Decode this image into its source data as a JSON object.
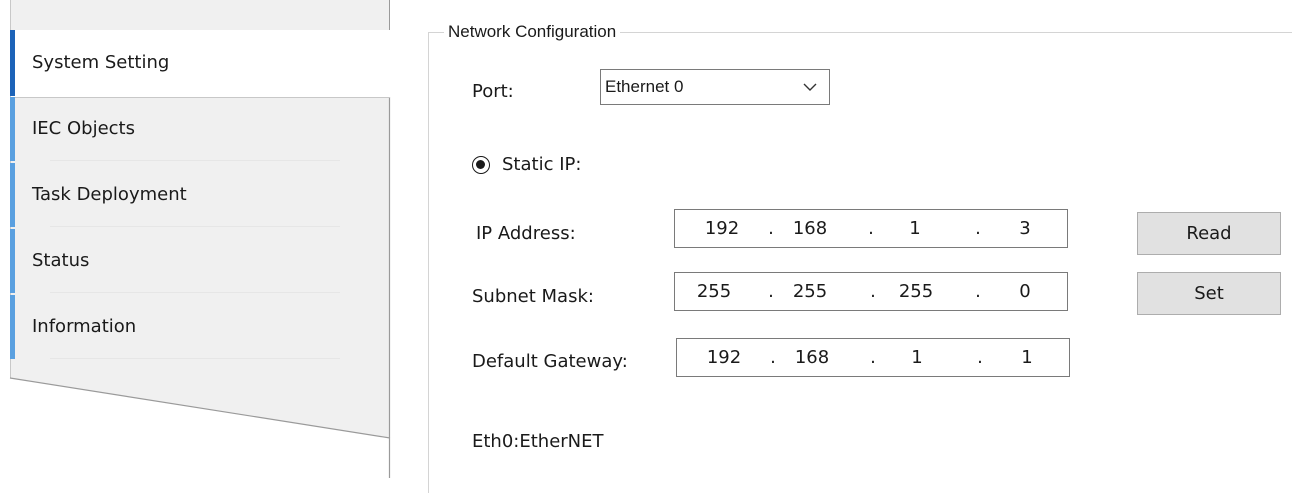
{
  "sidebar": {
    "items": [
      {
        "label": "System Setting",
        "active": true
      },
      {
        "label": "IEC Objects",
        "active": false
      },
      {
        "label": "Task Deployment",
        "active": false
      },
      {
        "label": "Status",
        "active": false
      },
      {
        "label": "Information",
        "active": false
      }
    ]
  },
  "network": {
    "group_title": "Network Configuration",
    "port_label": "Port:",
    "port_value": "Ethernet 0",
    "static_ip_label": "Static IP:",
    "static_ip_selected": true,
    "ip_address_label": "IP Address:",
    "ip_address": [
      "192",
      "168",
      "1",
      "3"
    ],
    "subnet_mask_label": "Subnet Mask:",
    "subnet_mask": [
      "255",
      "255",
      "255",
      "0"
    ],
    "default_gateway_label": "Default Gateway:",
    "default_gateway": [
      "192",
      "168",
      "1",
      "1"
    ],
    "ip_separator": ".",
    "read_button": "Read",
    "set_button": "Set",
    "interface_text": "Eth0:EtherNET"
  },
  "colors": {
    "accent_active": "#1c63b8",
    "accent": "#5aa0e0",
    "sidebar_bg": "#f0f0f0",
    "button_bg": "#e1e1e1"
  }
}
